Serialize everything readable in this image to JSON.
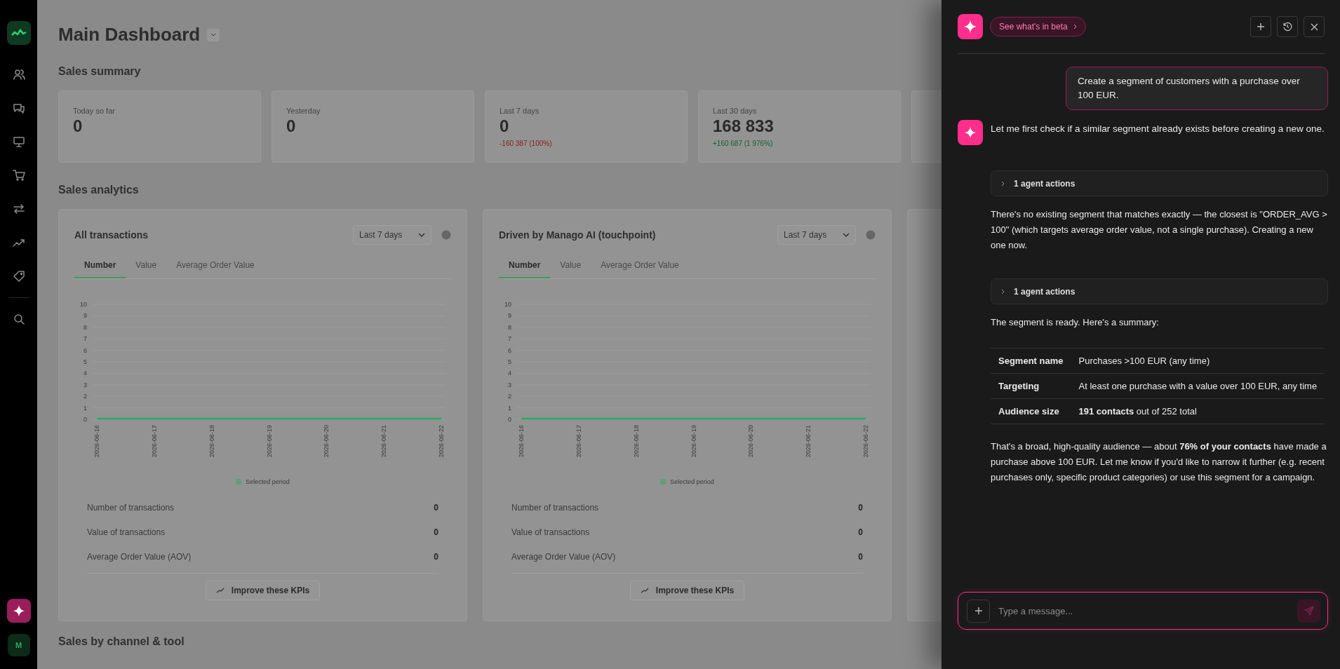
{
  "sidebar": {
    "avatar": {
      "initial": "M"
    }
  },
  "dashboard": {
    "title": "Main Dashboard",
    "summary": {
      "title": "Sales summary",
      "cards": [
        {
          "label": "Today so far",
          "value": "0"
        },
        {
          "label": "Yesterday",
          "value": "0"
        },
        {
          "label": "Last 7 days",
          "value": "0",
          "change": {
            "text": "-160 387 (100%)",
            "color": "#8a2020"
          }
        },
        {
          "label": "Last 30 days",
          "value": "168 833",
          "change": {
            "text": "+160 687 (1 976%)",
            "color": "#17602f"
          }
        }
      ]
    },
    "analytics": {
      "title": "Sales analytics",
      "cards": [
        {
          "title": "All transactions",
          "period": "Last 7 days",
          "tabs": [
            {
              "label": "Number",
              "selected": true
            },
            {
              "label": "Value",
              "selected": false
            },
            {
              "label": "Average Order Value",
              "selected": false
            }
          ],
          "chart_data": {
            "type": "line",
            "categories": [
              "2026-06-16",
              "2026-06-17",
              "2026-06-18",
              "2026-06-19",
              "2026-06-20",
              "2026-06-21",
              "2026-06-22"
            ],
            "series": [
              {
                "name": "Selected period",
                "color": "#2fa866",
                "values": [
                  0,
                  0,
                  0,
                  0,
                  0,
                  0,
                  0
                ]
              }
            ],
            "ylim": [
              0,
              10
            ],
            "yticks": [
              0,
              1,
              2,
              3,
              4,
              5,
              6,
              7,
              8,
              9,
              10
            ],
            "grid": true
          },
          "stats": [
            {
              "label": "Number of transactions",
              "value": "0"
            },
            {
              "label": "Value of transactions",
              "value": "0"
            },
            {
              "label": "Average Order Value (AOV)",
              "value": "0"
            }
          ],
          "action": "Improve these KPIs"
        },
        {
          "title": "Driven by Manago AI (touchpoint)",
          "period": "Last 7 days",
          "tabs": [
            {
              "label": "Number",
              "selected": true
            },
            {
              "label": "Value",
              "selected": false
            },
            {
              "label": "Average Order Value",
              "selected": false
            }
          ],
          "chart_data": {
            "type": "line",
            "categories": [
              "2026-06-16",
              "2026-06-17",
              "2026-06-18",
              "2026-06-19",
              "2026-06-20",
              "2026-06-21",
              "2026-06-22"
            ],
            "series": [
              {
                "name": "Selected period",
                "color": "#2fa866",
                "values": [
                  0,
                  0,
                  0,
                  0,
                  0,
                  0,
                  0
                ]
              }
            ],
            "ylim": [
              0,
              10
            ],
            "yticks": [
              0,
              1,
              2,
              3,
              4,
              5,
              6,
              7,
              8,
              9,
              10
            ],
            "grid": true
          },
          "stats": [
            {
              "label": "Number of transactions",
              "value": "0"
            },
            {
              "label": "Value of transactions",
              "value": "0"
            },
            {
              "label": "Average Order Value (AOV)",
              "value": "0"
            }
          ],
          "action": "Improve these KPIs"
        }
      ]
    },
    "next_section": {
      "title": "Sales by channel & tool"
    }
  },
  "assistant_panel": {
    "beta_link": "See what's in beta",
    "messages": [
      {
        "kind": "user",
        "text": "Create a segment of customers with a purchase over 100 EUR."
      },
      {
        "kind": "assistant",
        "text": "Let me first check if a similar segment already exists before creating a new one."
      },
      {
        "kind": "actions",
        "label": "1 agent actions",
        "expanded": false
      },
      {
        "kind": "text",
        "text": "There's no existing segment that matches exactly — the closest is \"ORDER_AVG > 100\" (which targets average order value, not a single purchase). Creating a new one now."
      },
      {
        "kind": "actions",
        "label": "1 agent actions",
        "expanded": false
      },
      {
        "kind": "text",
        "text": "The segment is ready. Here's a summary:"
      },
      {
        "kind": "table",
        "rows": [
          {
            "label": "Segment name",
            "value": "Purchases >100 EUR (any time)"
          },
          {
            "label": "Targeting",
            "value": "At least one purchase with a value over 100 EUR, any time"
          },
          {
            "label": "Audience size",
            "value": "**191 contacts** out of 252 total"
          }
        ]
      },
      {
        "kind": "text",
        "text": "That's a broad, high-quality audience — about **76% of your contacts** have made a purchase above 100 EUR. Let me know if you'd like to narrow it further (e.g. recent purchases only, specific product categories) or use this segment for a campaign."
      }
    ],
    "composer": {
      "placeholder": "Type a message..."
    }
  }
}
